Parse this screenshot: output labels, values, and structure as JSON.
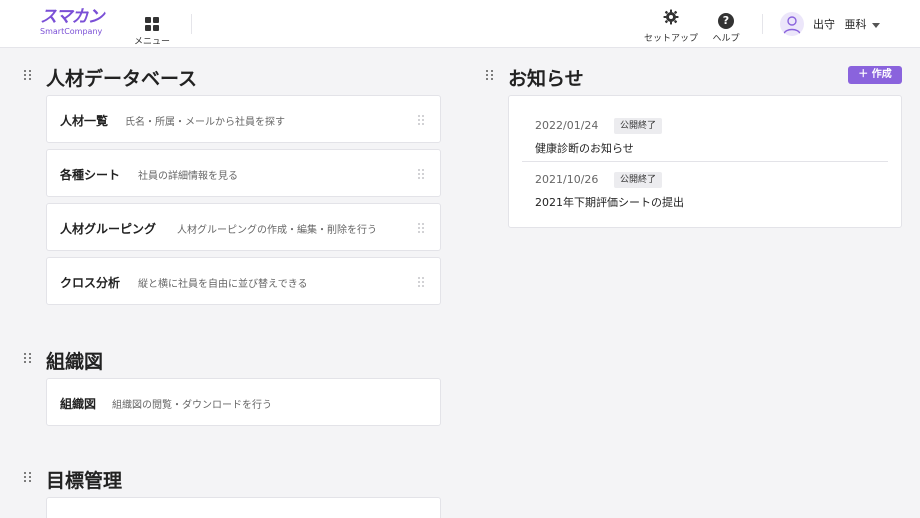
{
  "header": {
    "logo_main": "スマカン",
    "logo_sub": "SmartCompany",
    "menu_label": "メニュー",
    "setup_label": "セットアップ",
    "help_label": "ヘルプ",
    "help_glyph": "?",
    "user_name_first": "出守",
    "user_name_second": "亜科"
  },
  "sections": {
    "talent_db": {
      "title": "人材データベース",
      "cards": [
        {
          "title": "人材一覧",
          "desc": "氏名・所属・メールから社員を探す"
        },
        {
          "title": "各種シート",
          "desc": "社員の詳細情報を見る"
        },
        {
          "title": "人材グルーピング",
          "desc": "人材グルーピングの作成・編集・削除を行う"
        },
        {
          "title": "クロス分析",
          "desc": "縦と横に社員を自由に並び替えできる"
        }
      ]
    },
    "org_chart": {
      "title": "組織図",
      "cards": [
        {
          "title": "組織図",
          "desc": "組織図の閲覧・ダウンロードを行う"
        }
      ]
    },
    "goals": {
      "title": "目標管理"
    }
  },
  "news": {
    "title": "お知らせ",
    "create_label": "＋ 作成",
    "items": [
      {
        "date": "2022/01/24",
        "badge": "公開終了",
        "title": "健康診断のお知らせ"
      },
      {
        "date": "2021/10/26",
        "badge": "公開終了",
        "title": "2021年下期評価シートの提出"
      }
    ]
  },
  "colors": {
    "accent": "#8a63dd",
    "logo": "#7a4fd6"
  },
  "icons": [
    "grid-icon",
    "gear-icon",
    "help-icon",
    "user-icon",
    "drag-handle-icon",
    "plus-icon"
  ]
}
